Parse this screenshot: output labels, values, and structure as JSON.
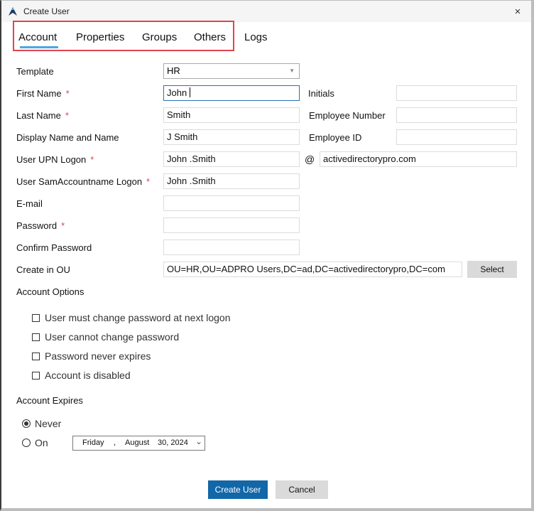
{
  "window": {
    "title": "Create User",
    "close_label": "×"
  },
  "tabs": [
    {
      "label": "Account",
      "active": true
    },
    {
      "label": "Properties",
      "active": false
    },
    {
      "label": "Groups",
      "active": false
    },
    {
      "label": "Others",
      "active": false
    },
    {
      "label": "Logs",
      "active": false
    }
  ],
  "accent_colors": {
    "primary_button": "#1167a8",
    "required_marker": "#e04452",
    "tab_underline": "#4aa8df",
    "highlight_box": "#e04452"
  },
  "form": {
    "required_marker": "*",
    "template": {
      "label": "Template",
      "value": "HR",
      "arrow": "▼"
    },
    "first_name": {
      "label": "First Name",
      "value": "John"
    },
    "last_name": {
      "label": "Last Name",
      "value": "Smith"
    },
    "display_name": {
      "label": "Display Name and Name",
      "value": "J Smith"
    },
    "upn_logon": {
      "label": "User UPN Logon",
      "value": "John .Smith"
    },
    "upn_at": "@",
    "upn_domain": {
      "value": "activedirectorypro.com"
    },
    "sam_logon": {
      "label": "User SamAccountname Logon",
      "value": "John .Smith"
    },
    "email": {
      "label": "E-mail",
      "value": ""
    },
    "password": {
      "label": "Password",
      "value": ""
    },
    "confirm_password": {
      "label": "Confirm Password",
      "value": ""
    },
    "create_in_ou": {
      "label": "Create in OU",
      "value": "OU=HR,OU=ADPRO Users,DC=ad,DC=activedirectorypro,DC=com",
      "select_label": "Select"
    },
    "initials": {
      "label": "Initials",
      "value": ""
    },
    "employee_number": {
      "label": "Employee Number",
      "value": ""
    },
    "employee_id": {
      "label": "Employee ID",
      "value": ""
    }
  },
  "account_options": {
    "heading": "Account Options",
    "items": [
      {
        "label": "User must change password at next logon",
        "checked": false
      },
      {
        "label": "User cannot change password",
        "checked": false
      },
      {
        "label": "Password never expires",
        "checked": false
      },
      {
        "label": "Account is disabled",
        "checked": false
      }
    ]
  },
  "account_expires": {
    "heading": "Account Expires",
    "never_label": "Never",
    "on_label": "On",
    "selected": "Never",
    "date": {
      "weekday": "Friday",
      "separator": ",",
      "month": "August",
      "day_year": "30, 2024",
      "chevron": "⌄"
    }
  },
  "footer": {
    "create_label": "Create User",
    "cancel_label": "Cancel"
  }
}
